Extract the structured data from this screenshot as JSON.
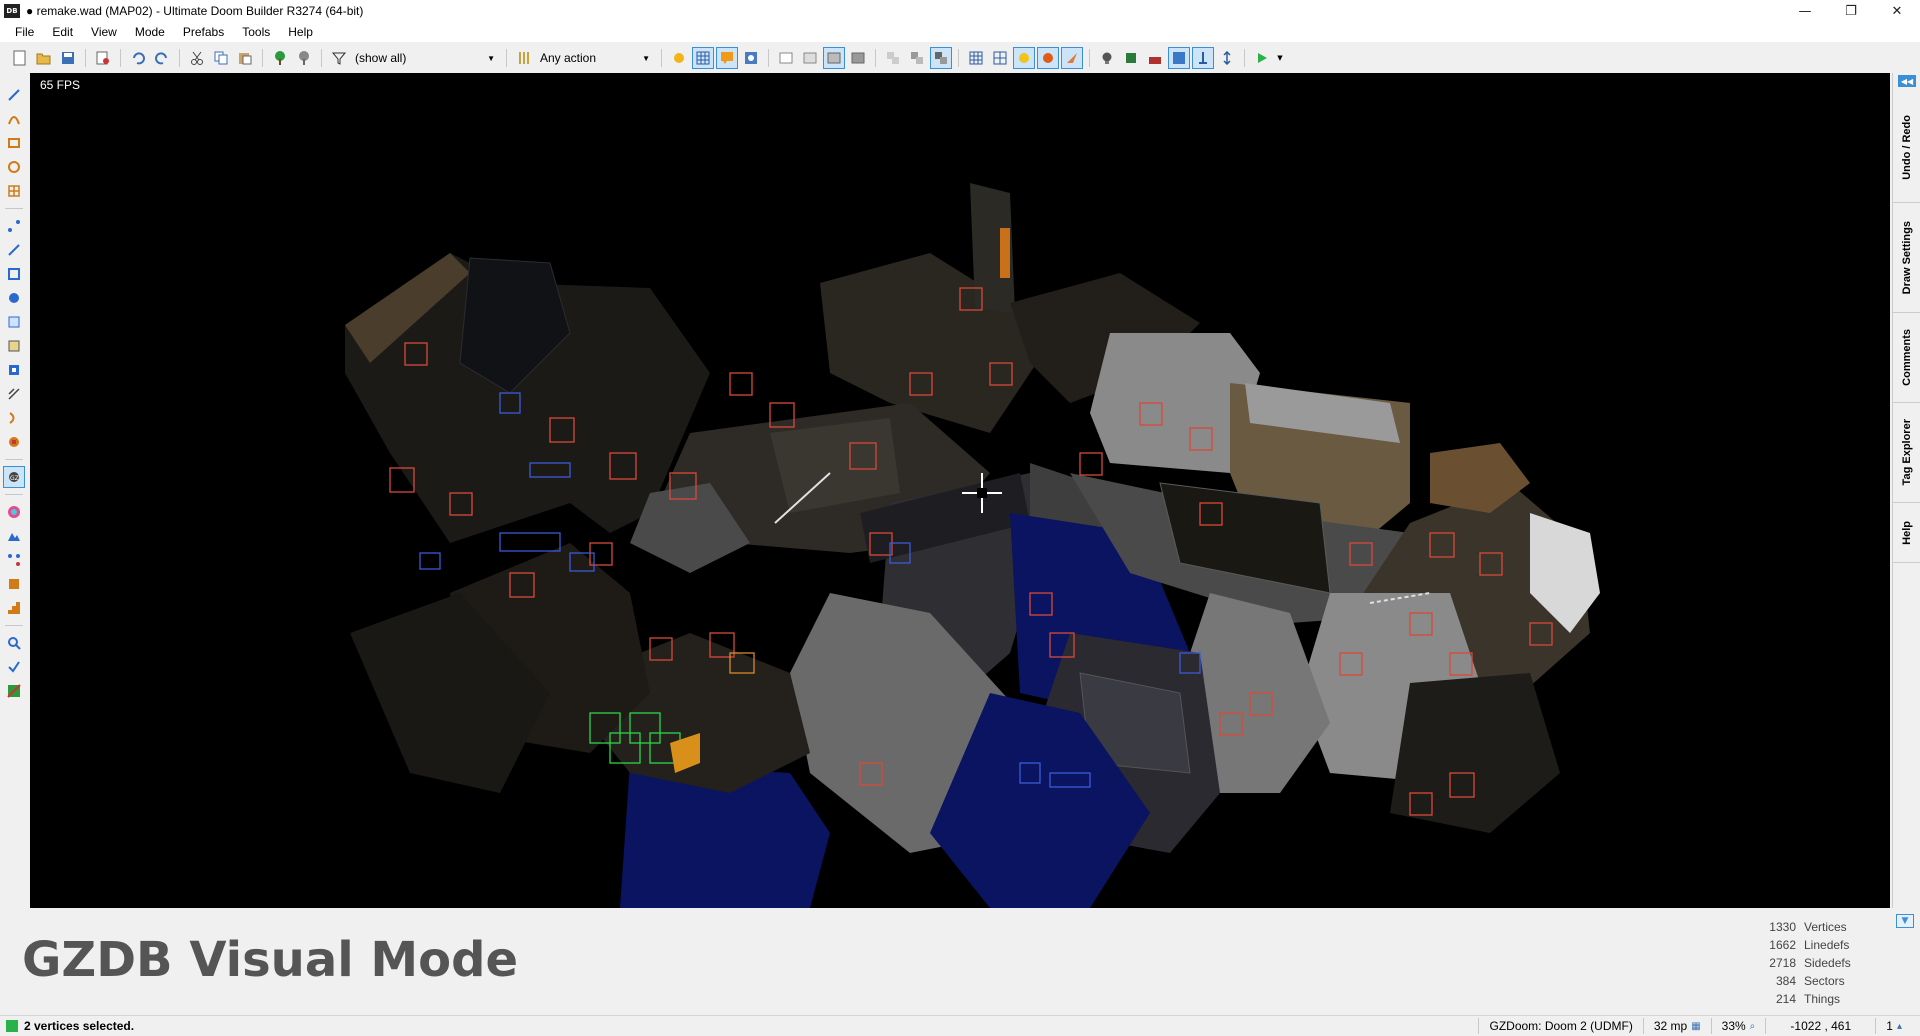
{
  "window": {
    "logo": "DB",
    "title": "● remake.wad (MAP02) - Ultimate Doom Builder R3274 (64-bit)",
    "minimize": "—",
    "restore": "❐",
    "close": "✕"
  },
  "menu": [
    "File",
    "Edit",
    "View",
    "Mode",
    "Prefabs",
    "Tools",
    "Help"
  ],
  "toolbar": {
    "filter_label": "(show all)",
    "action_label": "Any action",
    "combo_arrow": "▼",
    "icons": [
      "new-map-icon",
      "open-map-icon",
      "save-map-icon",
      "map-options-icon",
      "undo-icon",
      "redo-icon",
      "cut-icon",
      "copy-icon",
      "paste-icon",
      "tree-icon",
      "prefab-icon"
    ],
    "colors": {
      "accent": "#3b8fd6",
      "active_bg": "#cce4f7"
    }
  },
  "viewport": {
    "fps": "65 FPS",
    "background": "#000000"
  },
  "dock_tabs": [
    "Undo / Redo",
    "Draw Settings",
    "Comments",
    "Tag Explorer",
    "Help"
  ],
  "info_panel": {
    "mode_title": "GZDB Visual Mode",
    "stats": [
      {
        "value": "1330",
        "label": "Vertices"
      },
      {
        "value": "1662",
        "label": "Linedefs"
      },
      {
        "value": "2718",
        "label": "Sidedefs"
      },
      {
        "value": "384",
        "label": "Sectors"
      },
      {
        "value": "214",
        "label": "Things"
      }
    ]
  },
  "status": {
    "message": "2 vertices selected.",
    "engine": "GZDoom: Doom 2 (UDMF)",
    "grid": "32 mp",
    "zoom": "33%",
    "coords": "-1022 , 461",
    "page": "1"
  }
}
